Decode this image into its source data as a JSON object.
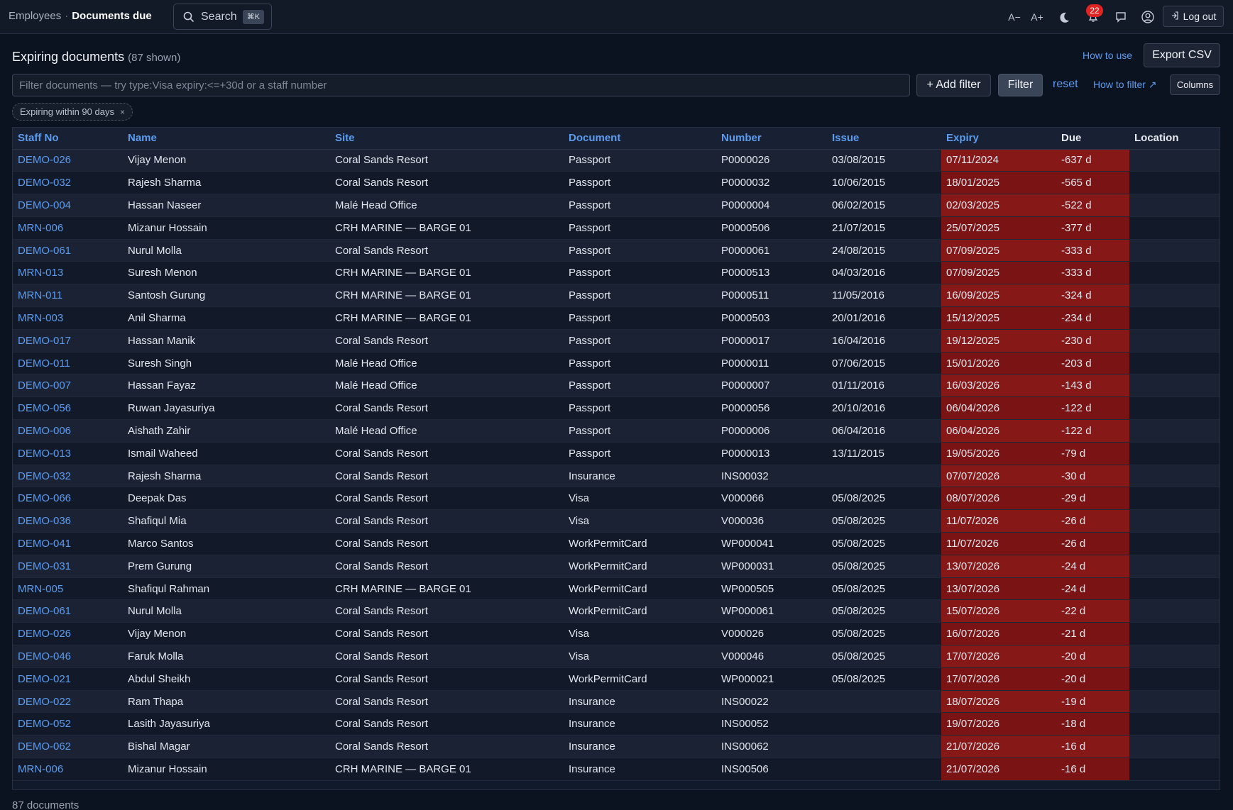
{
  "breadcrumb": {
    "parent": "Employees",
    "separator": "·",
    "current": "Documents due"
  },
  "search": {
    "label": "Search",
    "shortcut": "⌘K"
  },
  "toolbar": {
    "font_decrease": "A−",
    "font_increase": "A+",
    "notifications_count": "22",
    "logout_label": "Log out"
  },
  "header": {
    "title": "Expiring documents",
    "count": "(87 shown)",
    "how_to_use": "How to use",
    "export_label": "Export CSV"
  },
  "filter": {
    "placeholder": "Filter documents — try type:Visa expiry:<=+30d or a staff number",
    "add_filter": "+ Add filter",
    "filter_button": "Filter",
    "reset": "reset",
    "how_to_filter": "How to filter ↗",
    "columns": "Columns",
    "active_chip": "Expiring within 90 days",
    "chip_remove": "×"
  },
  "table": {
    "columns": [
      "Staff No",
      "Name",
      "Site",
      "Document",
      "Number",
      "Issue",
      "Expiry",
      "Due",
      "Location"
    ],
    "rows": [
      [
        "DEMO-026",
        "Vijay Menon",
        "Coral Sands Resort",
        "Passport",
        "P0000026",
        "03/08/2015",
        "07/11/2024",
        "-637 d",
        ""
      ],
      [
        "DEMO-032",
        "Rajesh Sharma",
        "Coral Sands Resort",
        "Passport",
        "P0000032",
        "10/06/2015",
        "18/01/2025",
        "-565 d",
        ""
      ],
      [
        "DEMO-004",
        "Hassan Naseer",
        "Malé Head Office",
        "Passport",
        "P0000004",
        "06/02/2015",
        "02/03/2025",
        "-522 d",
        ""
      ],
      [
        "MRN-006",
        "Mizanur Hossain",
        "CRH MARINE — BARGE 01",
        "Passport",
        "P0000506",
        "21/07/2015",
        "25/07/2025",
        "-377 d",
        ""
      ],
      [
        "DEMO-061",
        "Nurul Molla",
        "Coral Sands Resort",
        "Passport",
        "P0000061",
        "24/08/2015",
        "07/09/2025",
        "-333 d",
        ""
      ],
      [
        "MRN-013",
        "Suresh Menon",
        "CRH MARINE — BARGE 01",
        "Passport",
        "P0000513",
        "04/03/2016",
        "07/09/2025",
        "-333 d",
        ""
      ],
      [
        "MRN-011",
        "Santosh Gurung",
        "CRH MARINE — BARGE 01",
        "Passport",
        "P0000511",
        "11/05/2016",
        "16/09/2025",
        "-324 d",
        ""
      ],
      [
        "MRN-003",
        "Anil Sharma",
        "CRH MARINE — BARGE 01",
        "Passport",
        "P0000503",
        "20/01/2016",
        "15/12/2025",
        "-234 d",
        ""
      ],
      [
        "DEMO-017",
        "Hassan Manik",
        "Coral Sands Resort",
        "Passport",
        "P0000017",
        "16/04/2016",
        "19/12/2025",
        "-230 d",
        ""
      ],
      [
        "DEMO-011",
        "Suresh Singh",
        "Malé Head Office",
        "Passport",
        "P0000011",
        "07/06/2015",
        "15/01/2026",
        "-203 d",
        ""
      ],
      [
        "DEMO-007",
        "Hassan Fayaz",
        "Malé Head Office",
        "Passport",
        "P0000007",
        "01/11/2016",
        "16/03/2026",
        "-143 d",
        ""
      ],
      [
        "DEMO-056",
        "Ruwan Jayasuriya",
        "Coral Sands Resort",
        "Passport",
        "P0000056",
        "20/10/2016",
        "06/04/2026",
        "-122 d",
        ""
      ],
      [
        "DEMO-006",
        "Aishath Zahir",
        "Malé Head Office",
        "Passport",
        "P0000006",
        "06/04/2016",
        "06/04/2026",
        "-122 d",
        ""
      ],
      [
        "DEMO-013",
        "Ismail Waheed",
        "Coral Sands Resort",
        "Passport",
        "P0000013",
        "13/11/2015",
        "19/05/2026",
        "-79 d",
        ""
      ],
      [
        "DEMO-032",
        "Rajesh Sharma",
        "Coral Sands Resort",
        "Insurance",
        "INS00032",
        "",
        "07/07/2026",
        "-30 d",
        ""
      ],
      [
        "DEMO-066",
        "Deepak Das",
        "Coral Sands Resort",
        "Visa",
        "V000066",
        "05/08/2025",
        "08/07/2026",
        "-29 d",
        ""
      ],
      [
        "DEMO-036",
        "Shafiqul Mia",
        "Coral Sands Resort",
        "Visa",
        "V000036",
        "05/08/2025",
        "11/07/2026",
        "-26 d",
        ""
      ],
      [
        "DEMO-041",
        "Marco Santos",
        "Coral Sands Resort",
        "WorkPermitCard",
        "WP000041",
        "05/08/2025",
        "11/07/2026",
        "-26 d",
        ""
      ],
      [
        "DEMO-031",
        "Prem Gurung",
        "Coral Sands Resort",
        "WorkPermitCard",
        "WP000031",
        "05/08/2025",
        "13/07/2026",
        "-24 d",
        ""
      ],
      [
        "MRN-005",
        "Shafiqul Rahman",
        "CRH MARINE — BARGE 01",
        "WorkPermitCard",
        "WP000505",
        "05/08/2025",
        "13/07/2026",
        "-24 d",
        ""
      ],
      [
        "DEMO-061",
        "Nurul Molla",
        "Coral Sands Resort",
        "WorkPermitCard",
        "WP000061",
        "05/08/2025",
        "15/07/2026",
        "-22 d",
        ""
      ],
      [
        "DEMO-026",
        "Vijay Menon",
        "Coral Sands Resort",
        "Visa",
        "V000026",
        "05/08/2025",
        "16/07/2026",
        "-21 d",
        ""
      ],
      [
        "DEMO-046",
        "Faruk Molla",
        "Coral Sands Resort",
        "Visa",
        "V000046",
        "05/08/2025",
        "17/07/2026",
        "-20 d",
        ""
      ],
      [
        "DEMO-021",
        "Abdul Sheikh",
        "Coral Sands Resort",
        "WorkPermitCard",
        "WP000021",
        "05/08/2025",
        "17/07/2026",
        "-20 d",
        ""
      ],
      [
        "DEMO-022",
        "Ram Thapa",
        "Coral Sands Resort",
        "Insurance",
        "INS00022",
        "",
        "18/07/2026",
        "-19 d",
        ""
      ],
      [
        "DEMO-052",
        "Lasith Jayasuriya",
        "Coral Sands Resort",
        "Insurance",
        "INS00052",
        "",
        "19/07/2026",
        "-18 d",
        ""
      ],
      [
        "DEMO-062",
        "Bishal Magar",
        "Coral Sands Resort",
        "Insurance",
        "INS00062",
        "",
        "21/07/2026",
        "-16 d",
        ""
      ],
      [
        "MRN-006",
        "Mizanur Hossain",
        "CRH MARINE — BARGE 01",
        "Insurance",
        "INS00506",
        "",
        "21/07/2026",
        "-16 d",
        ""
      ]
    ]
  },
  "footer": {
    "count_label": "87 documents"
  },
  "colors": {
    "link": "#5b9cf0",
    "expired": "#7a1414",
    "background": "#0b1220",
    "badge": "#e02424"
  }
}
